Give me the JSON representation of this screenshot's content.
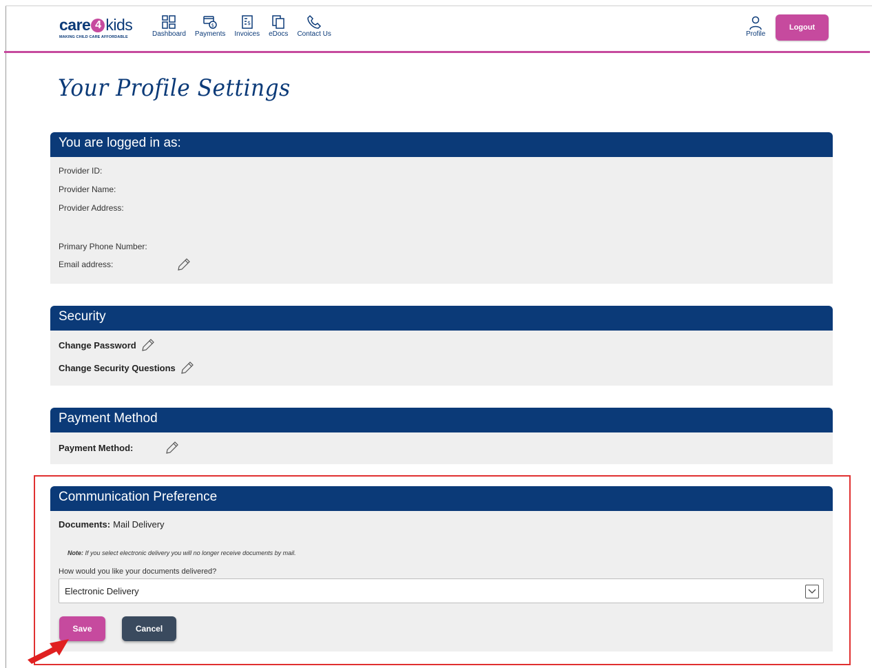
{
  "header": {
    "logo": {
      "care": "care",
      "four": "4",
      "kids": "kids",
      "tagline": "MAKING CHILD CARE AFFORDABLE"
    },
    "nav": [
      {
        "label": "Dashboard",
        "icon": "dashboard-icon"
      },
      {
        "label": "Payments",
        "icon": "payments-icon"
      },
      {
        "label": "Invoices",
        "icon": "invoices-icon"
      },
      {
        "label": "eDocs",
        "icon": "edocs-icon"
      },
      {
        "label": "Contact Us",
        "icon": "phone-icon"
      }
    ],
    "profile_label": "Profile",
    "logout_label": "Logout"
  },
  "page_title": "Your Profile Settings",
  "logged_in": {
    "title": "You are logged in as:",
    "provider_id_label": "Provider ID:",
    "provider_name_label": "Provider Name:",
    "provider_address_label": "Provider Address:",
    "phone_label": "Primary Phone Number:",
    "email_label": "Email address:"
  },
  "security": {
    "title": "Security",
    "change_password": "Change Password",
    "change_questions": "Change Security Questions"
  },
  "payment": {
    "title": "Payment Method",
    "label": "Payment Method:"
  },
  "communication": {
    "title": "Communication Preference",
    "documents_label": "Documents:",
    "documents_value": "Mail Delivery",
    "note_label": "Note:",
    "note_text": "If you select electronic delivery you will no longer receive documents by mail.",
    "question": "How would you like your documents delivered?",
    "selected_option": "Electronic Delivery",
    "save_label": "Save",
    "cancel_label": "Cancel"
  },
  "colors": {
    "navy": "#0b3a78",
    "magenta": "#c64a9e",
    "panel": "#efefef",
    "cancel": "#3a4a5e",
    "highlight": "#e03030"
  }
}
